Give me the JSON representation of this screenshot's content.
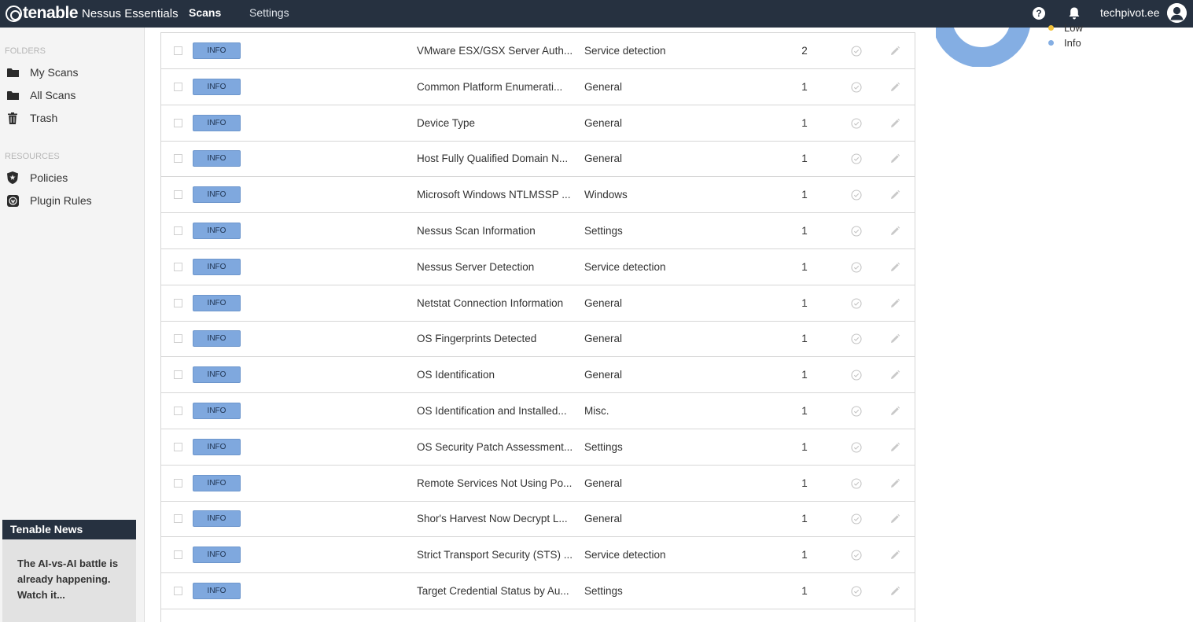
{
  "topbar": {
    "brand": "tenable",
    "product": "Nessus Essentials",
    "nav": {
      "scans": "Scans",
      "settings": "Settings"
    },
    "help": "?",
    "username": "techpivot.ee"
  },
  "sidebar": {
    "folders_label": "FOLDERS",
    "folders": [
      {
        "label": "My Scans",
        "icon": "folder-icon"
      },
      {
        "label": "All Scans",
        "icon": "folder-icon"
      },
      {
        "label": "Trash",
        "icon": "trash-icon"
      }
    ],
    "resources_label": "RESOURCES",
    "resources": [
      {
        "label": "Policies",
        "icon": "shield-icon"
      },
      {
        "label": "Plugin Rules",
        "icon": "plugin-rules-icon"
      }
    ],
    "news": {
      "title": "Tenable News",
      "body_lines": [
        "The AI-vs-AI battle is",
        "already happening.",
        "Watch it..."
      ]
    }
  },
  "table": {
    "rows": [
      {
        "severity": "INFO",
        "name": "VMware ESX/GSX Server Auth...",
        "family": "Service detection",
        "count": "2"
      },
      {
        "severity": "INFO",
        "name": "Common Platform Enumerati...",
        "family": "General",
        "count": "1"
      },
      {
        "severity": "INFO",
        "name": "Device Type",
        "family": "General",
        "count": "1"
      },
      {
        "severity": "INFO",
        "name": "Host Fully Qualified Domain N...",
        "family": "General",
        "count": "1"
      },
      {
        "severity": "INFO",
        "name": "Microsoft Windows NTLMSSP ...",
        "family": "Windows",
        "count": "1"
      },
      {
        "severity": "INFO",
        "name": "Nessus Scan Information",
        "family": "Settings",
        "count": "1"
      },
      {
        "severity": "INFO",
        "name": "Nessus Server Detection",
        "family": "Service detection",
        "count": "1"
      },
      {
        "severity": "INFO",
        "name": "Netstat Connection Information",
        "family": "General",
        "count": "1"
      },
      {
        "severity": "INFO",
        "name": "OS Fingerprints Detected",
        "family": "General",
        "count": "1"
      },
      {
        "severity": "INFO",
        "name": "OS Identification",
        "family": "General",
        "count": "1"
      },
      {
        "severity": "INFO",
        "name": "OS Identification and Installed...",
        "family": "Misc.",
        "count": "1"
      },
      {
        "severity": "INFO",
        "name": "OS Security Patch Assessment...",
        "family": "Settings",
        "count": "1"
      },
      {
        "severity": "INFO",
        "name": "Remote Services Not Using Po...",
        "family": "General",
        "count": "1"
      },
      {
        "severity": "INFO",
        "name": "Shor's Harvest Now Decrypt L...",
        "family": "General",
        "count": "1"
      },
      {
        "severity": "INFO",
        "name": "Strict Transport Security (STS) ...",
        "family": "Service detection",
        "count": "1"
      },
      {
        "severity": "INFO",
        "name": "Target Credential Status by Au...",
        "family": "Settings",
        "count": "1"
      }
    ]
  },
  "chart_data": {
    "type": "pie",
    "legend": [
      {
        "label": "Low",
        "color": "#f2c23c"
      },
      {
        "label": "Info",
        "color": "#84aee3"
      }
    ]
  },
  "colors": {
    "topbar": "#263140",
    "info_badge": "#7fa8de",
    "sidebar_bg": "#f4f4f4"
  }
}
